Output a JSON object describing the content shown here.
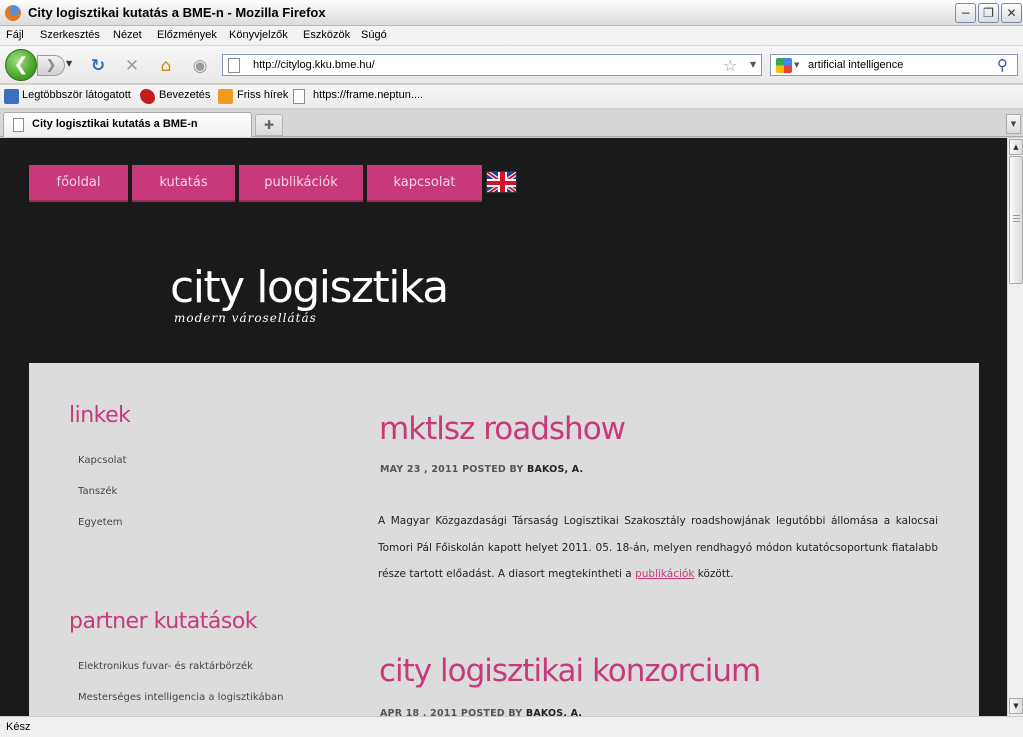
{
  "window": {
    "title": "City logisztikai kutatás a BME-n - Mozilla Firefox",
    "min_icon": "minimize-icon",
    "max_icon": "maximize-icon",
    "close_icon": "close-icon"
  },
  "menu": [
    "Fájl",
    "Szerkesztés",
    "Nézet",
    "Előzmények",
    "Könyvjelzők",
    "Eszközök",
    "Súgó"
  ],
  "navigation": {
    "url": "http://citylog.kku.bme.hu/",
    "search_value": "artificial intelligence"
  },
  "bookmarks": [
    {
      "label": "Legtöbbször látogatott",
      "icon": "most-visited-icon"
    },
    {
      "label": "Bevezetés",
      "icon": "bevezetes-icon"
    },
    {
      "label": "Friss hírek",
      "icon": "rss-icon"
    },
    {
      "label": "https://frame.neptun....",
      "icon": "page-icon"
    }
  ],
  "tabs": [
    {
      "label": "City logisztikai kutatás a BME-n"
    }
  ],
  "site": {
    "nav": [
      "főoldal",
      "kutatás",
      "publikációk",
      "kapcsolat"
    ],
    "title": "city logisztika",
    "subtitle": "modern városellátás",
    "accent_color": "#c8397a"
  },
  "sidebar": {
    "links_heading": "linkek",
    "links": [
      "Kapcsolat",
      "Tanszék",
      "Egyetem"
    ],
    "partners_heading": "partner kutatások",
    "partners": [
      "Elektronikus fuvar- és raktárbörzék",
      "Mesterséges intelligencia a logisztikában"
    ]
  },
  "posts": [
    {
      "title": "mktlsz roadshow",
      "date": "MAY 23 , 2011 POSTED BY",
      "author": "BAKOS, A.",
      "body_before": "A Magyar Közgazdasági Társaság Logisztikai Szakosztály roadshowjának legutóbbi állomása a kalocsai Tomori Pál Főiskolán kapott helyet 2011. 05. 18-án, melyen rendhagyó módon kutatócsoportunk fiatalabb része tartott előadást. A diasort megtekintheti a ",
      "link": "publikációk",
      "body_after": " között."
    },
    {
      "title": "city logisztikai konzorcium",
      "date": "APR 18 , 2011 POSTED BY",
      "author": "BAKOS, A."
    }
  ],
  "status": "Kész"
}
